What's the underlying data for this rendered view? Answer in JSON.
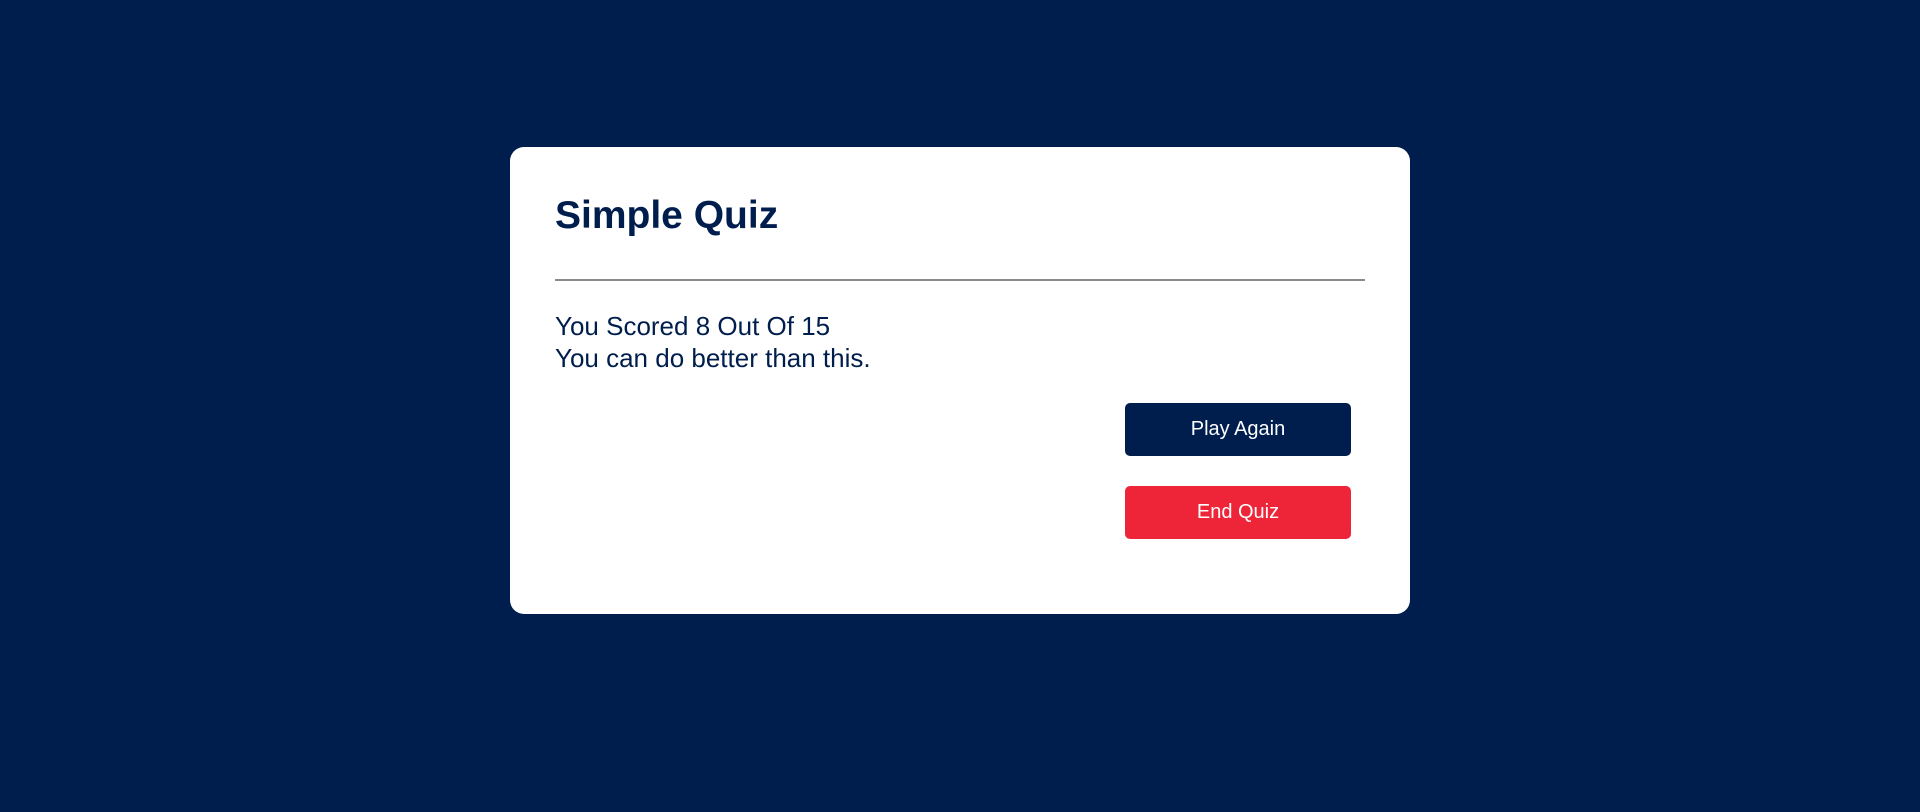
{
  "quiz": {
    "title": "Simple Quiz",
    "score_text": "You Scored 8 Out Of 15",
    "message": "You can do better than this.",
    "play_again_label": "Play Again",
    "end_quiz_label": "End Quiz"
  },
  "colors": {
    "background": "#001e4d",
    "card": "#ffffff",
    "primary": "#001e4d",
    "danger": "#ee2538",
    "divider": "#8a8a8a"
  }
}
